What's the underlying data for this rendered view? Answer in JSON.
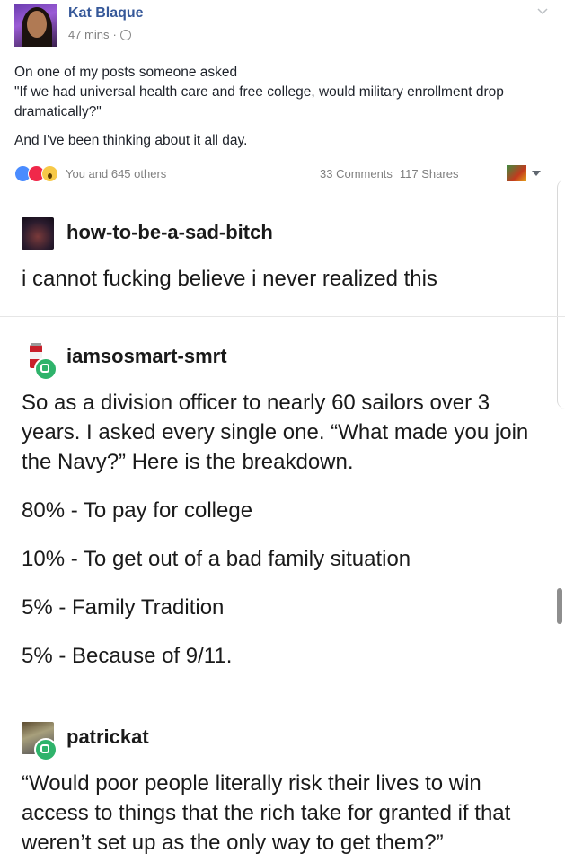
{
  "facebook": {
    "author": "Kat Blaque",
    "time": "47 mins",
    "meta_separator": "·",
    "post_lines": [
      "On one of my posts someone asked",
      "\"If we had universal health care and free college, would military enrollment drop dramatically?\"",
      "And I've been thinking about it all day."
    ],
    "reactions_text": "You and 645 others",
    "comments": "33 Comments",
    "shares": "117 Shares",
    "reaction_icons": [
      "like-icon",
      "love-icon",
      "wow-icon"
    ],
    "colors": {
      "name": "#365899",
      "like": "#4a8cff",
      "love": "#f0284a",
      "wow": "#f7c948"
    }
  },
  "tumblr": {
    "posts": [
      {
        "username": "how-to-be-a-sad-bitch",
        "paragraphs": [
          "i cannot fucking believe i never realized this"
        ]
      },
      {
        "username": "iamsosmart-smrt",
        "paragraphs": [
          "So as a division officer to nearly 60 sailors over 3 years. I asked every single one. “What made you join the Navy?” Here is the breakdown.",
          "80% - To pay for college",
          "10% - To get out of a bad family situation",
          "5% - Family Tradition",
          "5% - Because of 9/11."
        ]
      },
      {
        "username": "patrickat",
        "paragraphs": [
          "“Would poor people literally risk their lives to win access to things that the rich take for granted if that weren’t set up as the only way to get them?”"
        ]
      }
    ],
    "reblog_color": "#2fb36b"
  }
}
